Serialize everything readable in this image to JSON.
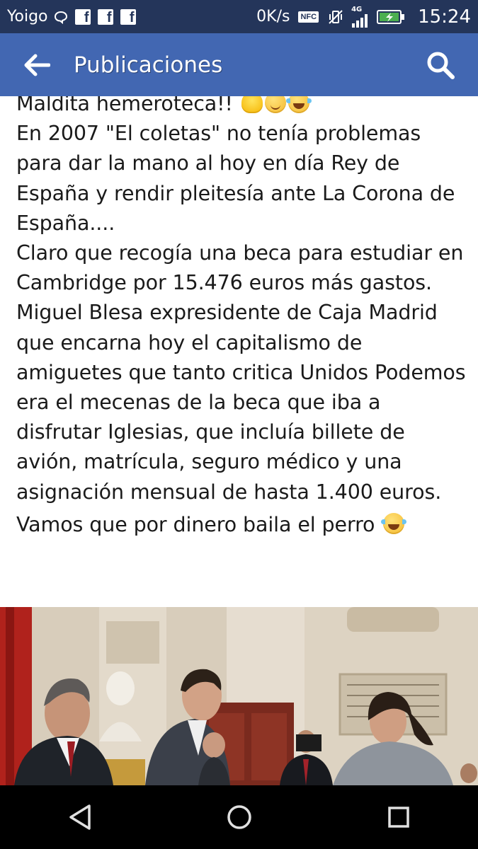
{
  "status_bar": {
    "carrier": "Yoigo",
    "notification_icons": [
      "chat-bubble-icon",
      "facebook-icon",
      "facebook-icon",
      "facebook-icon"
    ],
    "network_speed": "0K/s",
    "nfc_label": "NFC",
    "signal_label": "4G",
    "time": "15:24"
  },
  "app_bar": {
    "title": "Publicaciones",
    "back_icon": "arrow-left-icon",
    "search_icon": "search-icon"
  },
  "post": {
    "partial_line": "Maldita hemeroteca!!",
    "paragraph_1": "En 2007 \"El coletas\" no tenía problemas para dar la mano al hoy en día Rey de España y rendir pleitesía ante La Corona de España....",
    "paragraph_2": "Claro que recogía una beca para estudiar en Cambridge por 15.476 euros más gastos.",
    "paragraph_3": "Miguel Blesa expresidente de Caja Madrid que encarna hoy el capitalismo de amiguetes que tanto critica Unidos Podemos era el mecenas de la beca que iba a disfrutar Iglesias, que incluía billete de avión, matrícula, seguro médico y una asignación mensual de hasta 1.400 euros.",
    "paragraph_4": "Vamos que por dinero baila el perro"
  },
  "nav_bar": {
    "back_icon": "triangle-back-icon",
    "home_icon": "circle-home-icon",
    "recents_icon": "square-recents-icon"
  },
  "colors": {
    "status_bar_bg": "#24355a",
    "app_bar_bg": "#4267b2",
    "text": "#1a1a1a",
    "nav_bar_bg": "#000000"
  }
}
